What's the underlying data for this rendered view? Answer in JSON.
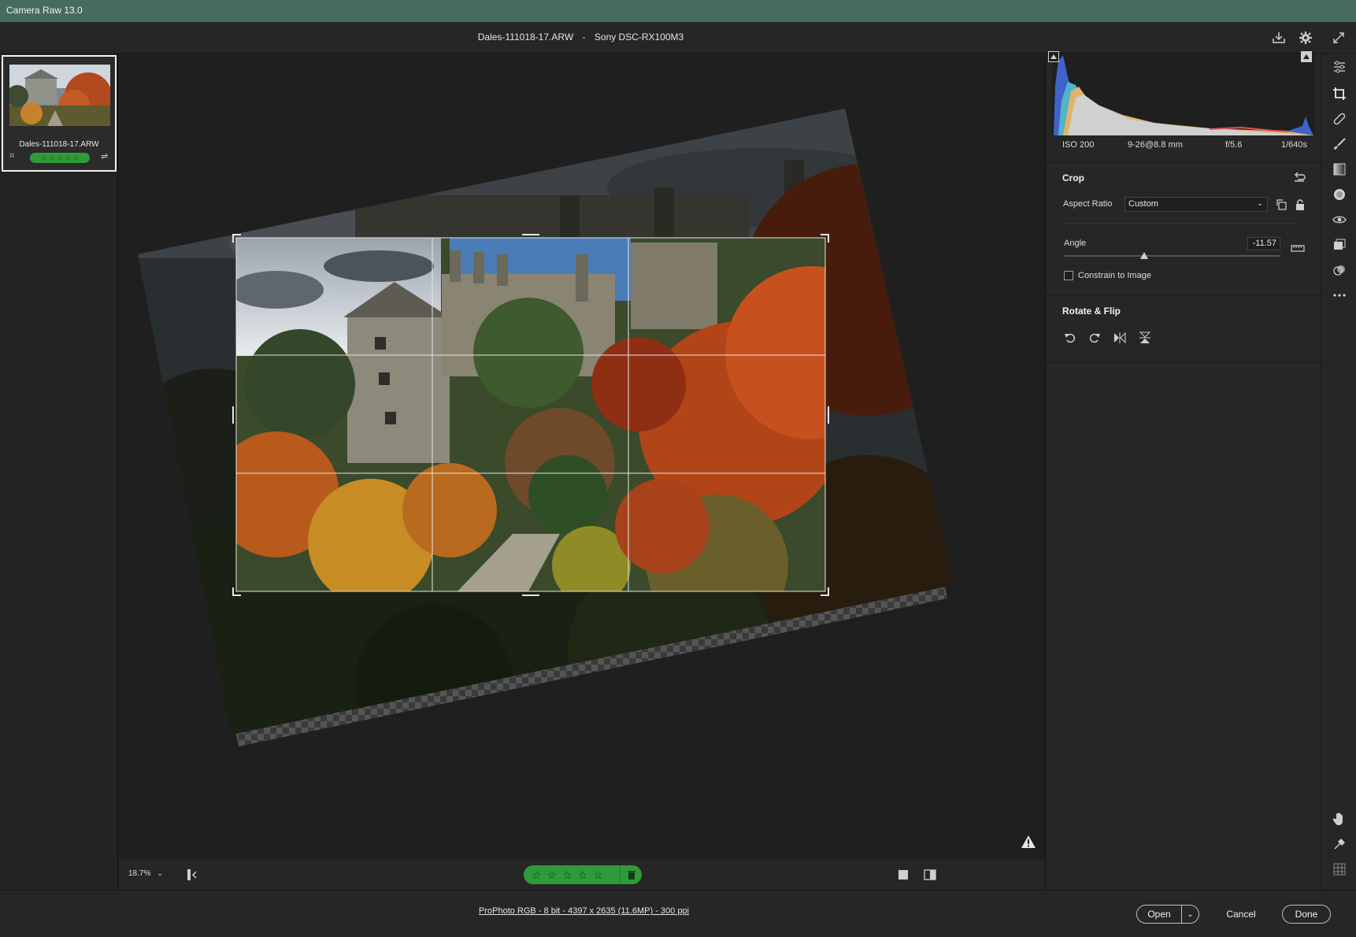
{
  "window": {
    "title": "Camera Raw 13.0"
  },
  "header": {
    "filename": "Dales-111018-17.ARW",
    "separator": "-",
    "camera": "Sony DSC-RX100M3"
  },
  "filmstrip": {
    "items": [
      {
        "name": "Dales-111018-17.ARW",
        "rating_stars": [
          "☆",
          "☆",
          "☆",
          "☆",
          "☆"
        ],
        "selected": true
      }
    ]
  },
  "exif": {
    "iso": "ISO 200",
    "lens": "9-26@8.8 mm",
    "aperture": "f/5.6",
    "shutter": "1/640s"
  },
  "crop": {
    "title": "Crop",
    "aspect_label": "Aspect Ratio",
    "aspect_value": "Custom",
    "angle_label": "Angle",
    "angle_value": "-11.57",
    "constrain_label": "Constrain to Image",
    "constrain_checked": false
  },
  "rotate_flip": {
    "title": "Rotate & Flip"
  },
  "bottombar": {
    "zoom": "18.7%",
    "rating_stars": [
      "☆",
      "☆",
      "☆",
      "☆",
      "☆"
    ],
    "trash_icon": "trash-icon"
  },
  "footer": {
    "info": "ProPhoto RGB - 8 bit - 4397 x 2635 (11.6MP) - 300 ppi",
    "open_label": "Open",
    "cancel_label": "Cancel",
    "done_label": "Done"
  },
  "colors": {
    "titlebar": "#456c5e",
    "accent_green": "#2f9a3a",
    "panel": "#262626",
    "canvas": "#1f1f1f"
  },
  "tools": [
    "edit-sliders-icon",
    "crop-icon",
    "healing-icon",
    "brush-icon",
    "linear-gradient-icon",
    "radial-filter-icon",
    "red-eye-icon",
    "snapshots-icon",
    "presets-icon",
    "more-icon",
    "hand-icon",
    "color-sampler-icon",
    "grid-icon"
  ]
}
